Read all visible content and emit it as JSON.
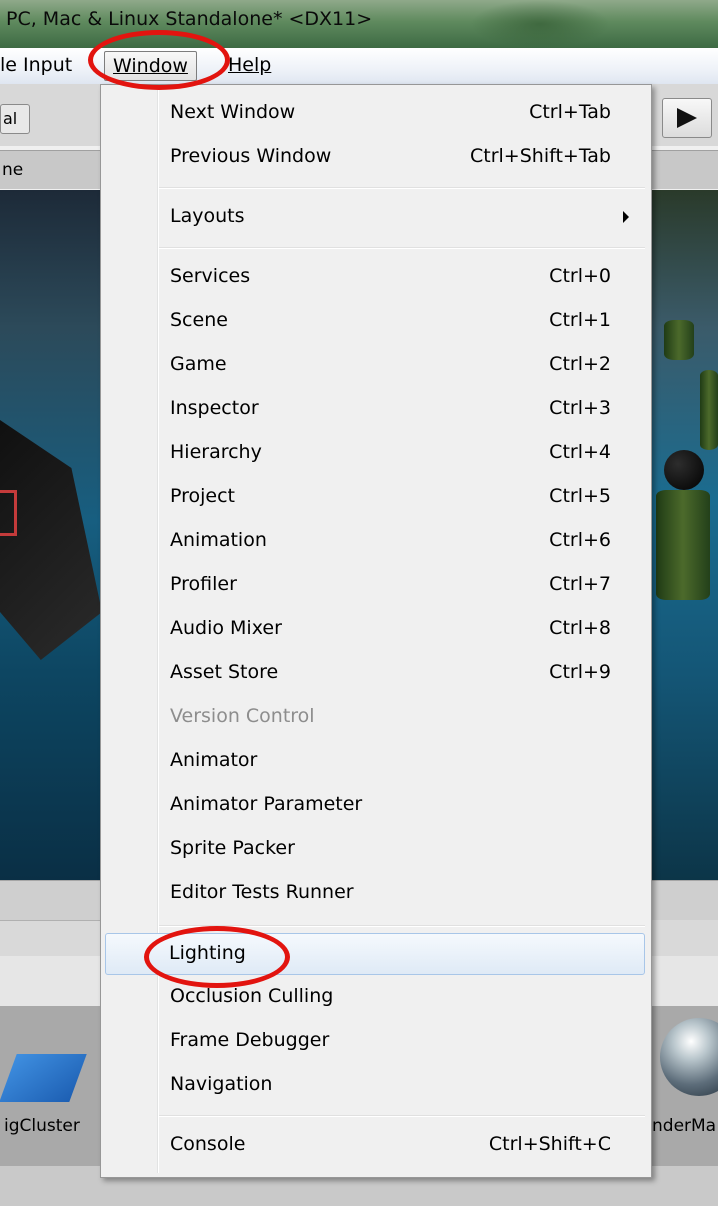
{
  "title_bar": {
    "text": "PC, Mac & Linux Standalone* <DX11>"
  },
  "menubar": {
    "file": "le Input",
    "window": "Window",
    "help": "Help"
  },
  "left_panel": {
    "tool_button": "al",
    "scene_tab": "ne",
    "asset_label": "igCluster"
  },
  "right_panel": {
    "asset_label": "nderMa"
  },
  "window_menu": {
    "items": [
      {
        "label": "Next Window",
        "shortcut": "Ctrl+Tab"
      },
      {
        "label": "Previous Window",
        "shortcut": "Ctrl+Shift+Tab"
      },
      {
        "label": "Layouts",
        "shortcut": ""
      },
      {
        "label": "Services",
        "shortcut": "Ctrl+0"
      },
      {
        "label": "Scene",
        "shortcut": "Ctrl+1"
      },
      {
        "label": "Game",
        "shortcut": "Ctrl+2"
      },
      {
        "label": "Inspector",
        "shortcut": "Ctrl+3"
      },
      {
        "label": "Hierarchy",
        "shortcut": "Ctrl+4"
      },
      {
        "label": "Project",
        "shortcut": "Ctrl+5"
      },
      {
        "label": "Animation",
        "shortcut": "Ctrl+6"
      },
      {
        "label": "Profiler",
        "shortcut": "Ctrl+7"
      },
      {
        "label": "Audio Mixer",
        "shortcut": "Ctrl+8"
      },
      {
        "label": "Asset Store",
        "shortcut": "Ctrl+9"
      },
      {
        "label": "Version Control",
        "shortcut": ""
      },
      {
        "label": "Animator",
        "shortcut": ""
      },
      {
        "label": "Animator Parameter",
        "shortcut": ""
      },
      {
        "label": "Sprite Packer",
        "shortcut": ""
      },
      {
        "label": "Editor Tests Runner",
        "shortcut": ""
      },
      {
        "label": "Lighting",
        "shortcut": ""
      },
      {
        "label": "Occlusion Culling",
        "shortcut": ""
      },
      {
        "label": "Frame Debugger",
        "shortcut": ""
      },
      {
        "label": "Navigation",
        "shortcut": ""
      },
      {
        "label": "Console",
        "shortcut": "Ctrl+Shift+C"
      }
    ]
  },
  "colors": {
    "annotation": "#e2140f",
    "hover_border": "#a8c6e8"
  }
}
